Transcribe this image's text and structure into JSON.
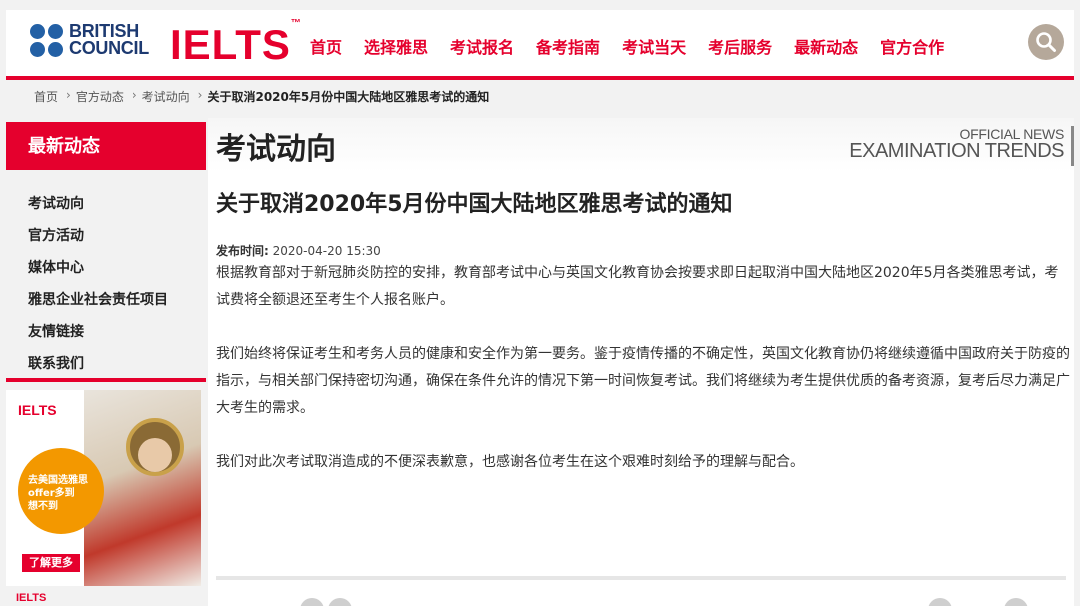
{
  "header": {
    "bc_logo_line1": "BRITISH",
    "bc_logo_line2": "COUNCIL",
    "ielts_logo": "IELTS",
    "ielts_tm": "™",
    "nav": [
      "首页",
      "选择雅思",
      "考试报名",
      "备考指南",
      "考试当天",
      "考后服务",
      "最新动态",
      "官方合作"
    ]
  },
  "breadcrumb": {
    "items": [
      "首页",
      "官方动态",
      "考试动向"
    ],
    "current": "关于取消2020年5月份中国大陆地区雅思考试的通知",
    "separator": "›"
  },
  "sidebar": {
    "title": "最新动态",
    "items": [
      "考试动向",
      "官方活动",
      "媒体中心",
      "雅思企业社会责任项目",
      "友情链接",
      "联系我们"
    ]
  },
  "promo": {
    "logo": "IELTS",
    "circle_line1": "去美国选雅思",
    "circle_line2": "offer多到",
    "circle_line3": "想不到",
    "more_button": "了解更多",
    "logo2": "IELTS"
  },
  "main": {
    "section_title": "考试动向",
    "official_line1": "OFFICIAL NEWS",
    "official_line2": "EXAMINATION TRENDS",
    "article_title": "关于取消2020年5月份中国大陆地区雅思考试的通知",
    "publish_label": "发布时间:",
    "publish_time": "2020-04-20 15:30",
    "paragraphs": [
      "根据教育部对于新冠肺炎防控的安排，教育部考试中心与英国文化教育协会按要求即日起取消中国大陆地区2020年5月各类雅思考试，考试费将全额退还至考生个人报名账户。",
      "我们始终将保证考生和考务人员的健康和安全作为第一要务。鉴于疫情传播的不确定性，英国文化教育协仍将继续遵循中国政府关于防疫的指示，与相关部门保持密切沟通，确保在条件允许的情况下第一时间恢复考试。我们将继续为考生提供优质的备考资源，复考后尽力满足广大考生的需求。",
      "我们对此次考试取消造成的不便深表歉意，也感谢各位考生在这个艰难时刻给予的理解与配合。"
    ]
  },
  "colors": {
    "brand_red": "#e5002d",
    "bc_blue": "#2360a5",
    "promo_orange": "#f39800"
  }
}
